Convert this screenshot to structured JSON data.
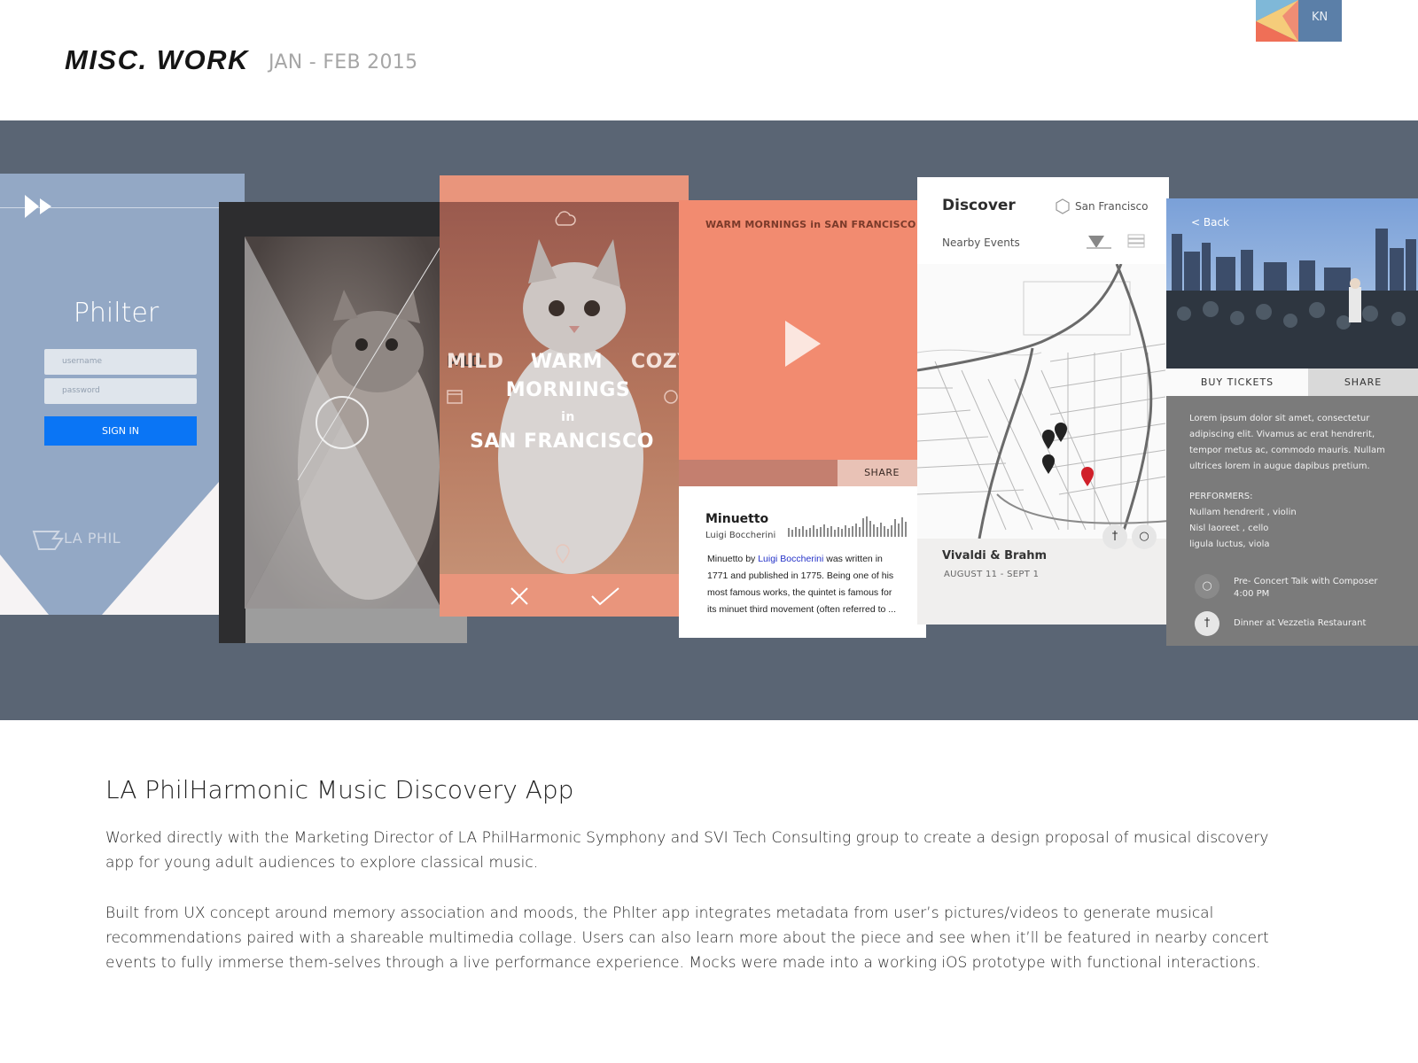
{
  "header": {
    "title": "MISC. WORK",
    "date_range": "JAN - FEB 2015",
    "logo_initials": "KN"
  },
  "screens": {
    "login": {
      "app_name": "Philter",
      "username_placeholder": "username",
      "password_placeholder": "password",
      "sign_in_label": "SIGN IN",
      "sponsor_logo_text": "LA PHIL"
    },
    "mood": {
      "left_mood": "MILD",
      "center_line1": "WARM",
      "center_line2": "MORNINGS",
      "center_line3": "in",
      "center_line4": "SAN FRANCISCO",
      "right_mood": "COZY"
    },
    "player": {
      "header": "WARM MORNINGS in SAN FRANCISCO",
      "share_label": "SHARE",
      "song_title": "Minuetto",
      "composer": "Luigi Boccherini",
      "desc_prefix": "Minuetto by ",
      "desc_link": "Luigi Boccherini",
      "desc_rest": " was written in 1771 and published in 1775. Being one of his most famous works, the quintet is famous for its minuet third movement (often referred to ..."
    },
    "discover": {
      "title": "Discover",
      "location": "San Francisco",
      "subtitle": "Nearby  Events",
      "event_title": "Vivaldi & Brahm",
      "event_dates": "AUGUST  11 - SEPT 1"
    },
    "event": {
      "back_label": "< Back",
      "buy_tickets_label": "BUY TICKETS",
      "share_label": "SHARE",
      "description": "Lorem ipsum dolor sit amet, consectetur adipiscing elit. Vivamus ac erat hendrerit, tempor metus ac, commodo mauris. Nullam ultrices lorem in augue dapibus pretium.",
      "performers_heading": "PERFORMERS:",
      "performers": [
        "Nullam hendrerit , violin",
        "Nisl laoreet , cello",
        "ligula luctus, viola"
      ],
      "talk_line1": "Pre- Concert Talk with Composer",
      "talk_line2": "4:00 PM",
      "dinner": "Dinner at Vezzetia Restaurant"
    }
  },
  "project": {
    "title": "LA PhilHarmonic Music Discovery App",
    "paragraph1": "Worked directly with the Marketing Director of LA PhilHarmonic Symphony and SVI Tech Consulting group to create a design proposal of musical discovery app for young adult audiences to explore classical music.",
    "paragraph2": "Built from UX concept around memory association and moods, the Phlter app integrates metadata from user’s pictures/videos to generate musical recommendations paired with a shareable multimedia collage. Users can also learn more about the piece and see when it’ll be featured in nearby concert events to fully immerse them-selves through a live performance experience. Mocks were made into a working iOS prototype with functional interactions."
  },
  "colors": {
    "band": "#5a6574",
    "login_bg": "#93a8c5",
    "sign_in": "#0a75f5",
    "coral": "#f28b70",
    "logo_coral": "#ef6f57",
    "logo_blue": "#5b7fa8",
    "logo_yellow": "#f5cc7a",
    "logo_lightblue": "#7fb8d8"
  },
  "icons": [
    "fast-forward-icon",
    "cloud-icon",
    "calendar-icon",
    "alarm-icon",
    "location-pin-icon",
    "close-icon",
    "check-icon",
    "play-icon",
    "map-pin-icon",
    "filter-icon",
    "list-icon",
    "fork-knife-icon",
    "speech-bubble-icon"
  ]
}
